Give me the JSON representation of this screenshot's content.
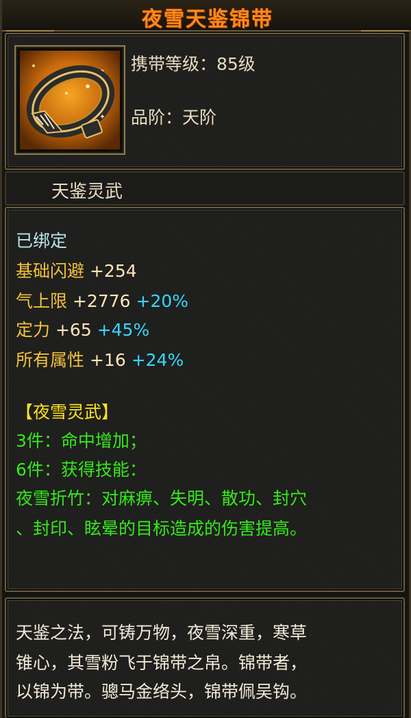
{
  "item": {
    "title": "夜雪天鉴锦带",
    "level_label": "携带等级：85级",
    "grade_label": "品阶：天阶",
    "name": "天鉴灵武"
  },
  "stats": {
    "bound": "已绑定",
    "dodge": {
      "label": "基础闪避",
      "value": "+254"
    },
    "qi": {
      "label": "气上限",
      "value": "+2776",
      "bonus": "+20%"
    },
    "focus": {
      "label": "定力",
      "value": "+65",
      "bonus": "+45%"
    },
    "all": {
      "label": "所有属性",
      "value": "+16",
      "bonus": "+24%"
    }
  },
  "set": {
    "name": "【夜雪灵武】",
    "lines": [
      "3件：命中增加；",
      "6件：获得技能：",
      "夜雪折竹：对麻痹、失明、散功、封穴",
      "、封印、眩晕的目标造成的伤害提高。"
    ]
  },
  "description": {
    "lines": [
      "天鉴之法，可铸万物，夜雪深重，寒草",
      "锥心，其雪粉飞于锦带之帛。锦带者，",
      "以锦为带。骢马金络头，锦带佩吴钩。"
    ]
  },
  "colors": {
    "title": "#ff8a1c",
    "bound": "#b8e8ee",
    "stat_label": "#f4c23a",
    "bonus": "#32d9ff",
    "set_name": "#ffe21a",
    "set_effect": "#34ea1a"
  },
  "icons": {
    "item_icon": "belt-icon"
  }
}
